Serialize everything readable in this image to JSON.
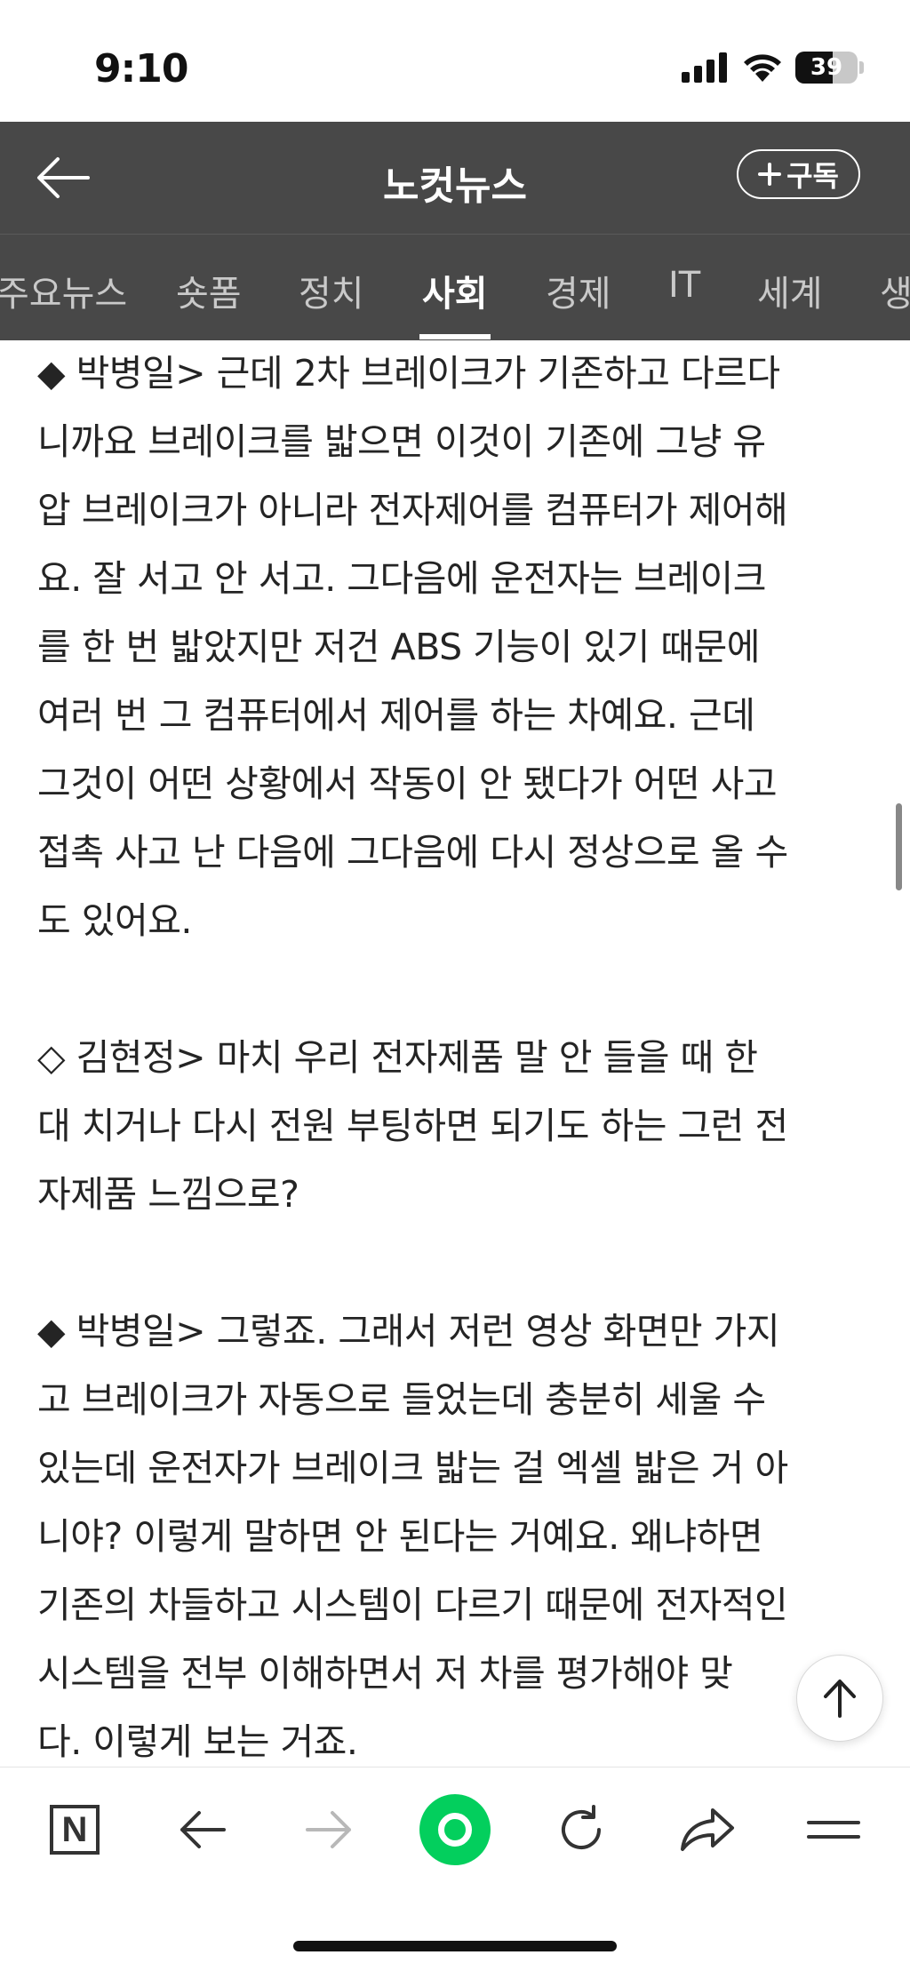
{
  "status_bar": {
    "time": "9:10",
    "battery": "39"
  },
  "header": {
    "title": "노컷뉴스",
    "subscribe_label": "구독"
  },
  "tabs": [
    {
      "label": "주요뉴스",
      "active": false
    },
    {
      "label": "숏폼",
      "active": false
    },
    {
      "label": "정치",
      "active": false
    },
    {
      "label": "사회",
      "active": true
    },
    {
      "label": "경제",
      "active": false
    },
    {
      "label": "IT",
      "active": false
    },
    {
      "label": "세계",
      "active": false
    },
    {
      "label": "생",
      "active": false
    }
  ],
  "article": {
    "paragraphs": [
      {
        "lines": [
          "◆ 박병일> 근데 2차 브레이크가 기존하고 다르다",
          "니까요 브레이크를 밟으면 이것이 기존에 그냥 유",
          "압 브레이크가 아니라 전자제어를 컴퓨터가 제어해",
          "요. 잘 서고 안 서고. 그다음에 운전자는 브레이크",
          "를 한 번 밟았지만 저건 ABS 기능이 있기 때문에",
          "여러 번 그 컴퓨터에서 제어를 하는 차예요. 근데",
          "그것이 어떤 상황에서 작동이 안 됐다가 어떤 사고",
          "접촉 사고 난 다음에 그다음에 다시 정상으로 올 수",
          "도 있어요."
        ]
      },
      {
        "lines": [
          "◇ 김현정> 마치 우리 전자제품 말 안 들을 때 한",
          "대 치거나 다시 전원 부팅하면 되기도 하는 그런 전",
          "자제품 느낌으로?"
        ]
      },
      {
        "lines": [
          "◆ 박병일> 그렇죠. 그래서 저런 영상 화면만 가지",
          "고 브레이크가 자동으로 들었는데 충분히 세울 수",
          "있는데 운전자가 브레이크 밟는 걸 엑셀 밟은 거 아",
          "니야? 이렇게 말하면 안 된다는 거예요. 왜냐하면",
          "기존의 차들하고 시스템이 다르기 때문에 전자적인",
          "시스템을 전부 이해하면서 저 차를 평가해야 맞",
          "다. 이렇게 보는 거죠."
        ]
      }
    ]
  },
  "toolbar": {
    "naver_logo_letter": "N"
  },
  "icons": [
    "back-arrow-icon",
    "plus-icon",
    "signal-icon",
    "wifi-icon",
    "battery-icon",
    "scroll-top-icon",
    "naver-home-icon",
    "browser-back-icon",
    "browser-forward-icon",
    "green-window-icon",
    "reload-icon",
    "share-icon",
    "menu-icon"
  ]
}
